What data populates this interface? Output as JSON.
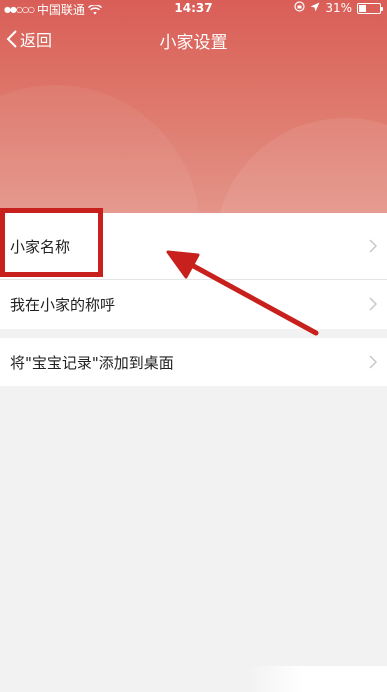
{
  "status_bar": {
    "signal": "●●○○○",
    "carrier": "中国联通",
    "time": "14:37",
    "battery": "31%"
  },
  "nav": {
    "back_label": "返回",
    "title": "小家设置"
  },
  "settings": {
    "items": [
      {
        "label": "小家名称"
      },
      {
        "label": "我在小家的称呼"
      },
      {
        "label": "将\"宝宝记录\"添加到桌面"
      }
    ]
  },
  "colors": {
    "header_top": "#d95e57",
    "header_bottom": "#e49488",
    "annotation_red": "#c8201c",
    "page_background": "#f2f2f2"
  },
  "icons": [
    "wifi-icon",
    "location-icon",
    "battery-icon",
    "back-chevron-icon",
    "chevron-right-icon"
  ]
}
